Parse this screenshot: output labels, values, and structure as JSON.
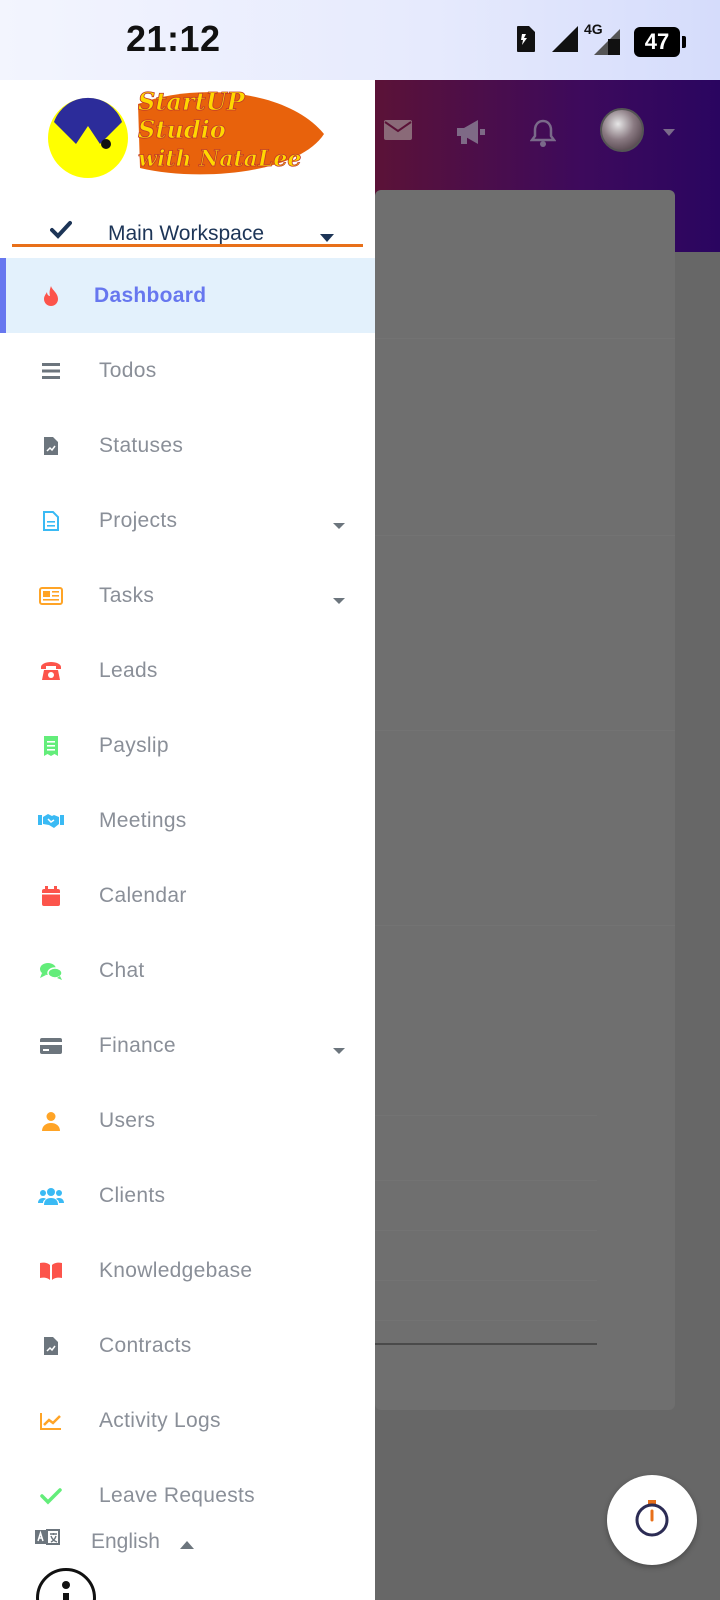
{
  "status_bar": {
    "time": "21:12",
    "network": "4G",
    "battery": "47"
  },
  "logo": {
    "line1": "StartUP",
    "line2": "Studio",
    "line3": "with NataLee"
  },
  "workspace": {
    "label": "Main Workspace"
  },
  "menu": {
    "items": [
      {
        "label": "Dashboard",
        "icon": "fire-icon",
        "color": "#fc544b"
      },
      {
        "label": "Todos",
        "icon": "list-icon",
        "color": "#6c757d"
      },
      {
        "label": "Statuses",
        "icon": "file-chart-icon",
        "color": "#6c757d"
      },
      {
        "label": "Projects",
        "icon": "file-icon",
        "color": "#3abaf4"
      },
      {
        "label": "Tasks",
        "icon": "newspaper-icon",
        "color": "#ffa426"
      },
      {
        "label": "Leads",
        "icon": "phone-icon",
        "color": "#fc544b"
      },
      {
        "label": "Payslip",
        "icon": "receipt-icon",
        "color": "#63ed7a"
      },
      {
        "label": "Meetings",
        "icon": "handshake-icon",
        "color": "#3abaf4"
      },
      {
        "label": "Calendar",
        "icon": "calendar-icon",
        "color": "#fc544b"
      },
      {
        "label": "Chat",
        "icon": "comments-icon",
        "color": "#63ed7a"
      },
      {
        "label": "Finance",
        "icon": "credit-card-icon",
        "color": "#6c757d"
      },
      {
        "label": "Users",
        "icon": "user-icon",
        "color": "#ffa426"
      },
      {
        "label": "Clients",
        "icon": "users-icon",
        "color": "#3abaf4"
      },
      {
        "label": "Knowledgebase",
        "icon": "book-icon",
        "color": "#fc544b"
      },
      {
        "label": "Contracts",
        "icon": "file-signature-icon",
        "color": "#6c757d"
      },
      {
        "label": "Activity Logs",
        "icon": "chart-line-icon",
        "color": "#ffa426"
      },
      {
        "label": "Leave Requests",
        "icon": "check-icon",
        "color": "#63ed7a"
      }
    ]
  },
  "language": {
    "label": "English"
  },
  "colors": {
    "accent": "#6777ef",
    "workspace_underline": "#e8701a"
  }
}
